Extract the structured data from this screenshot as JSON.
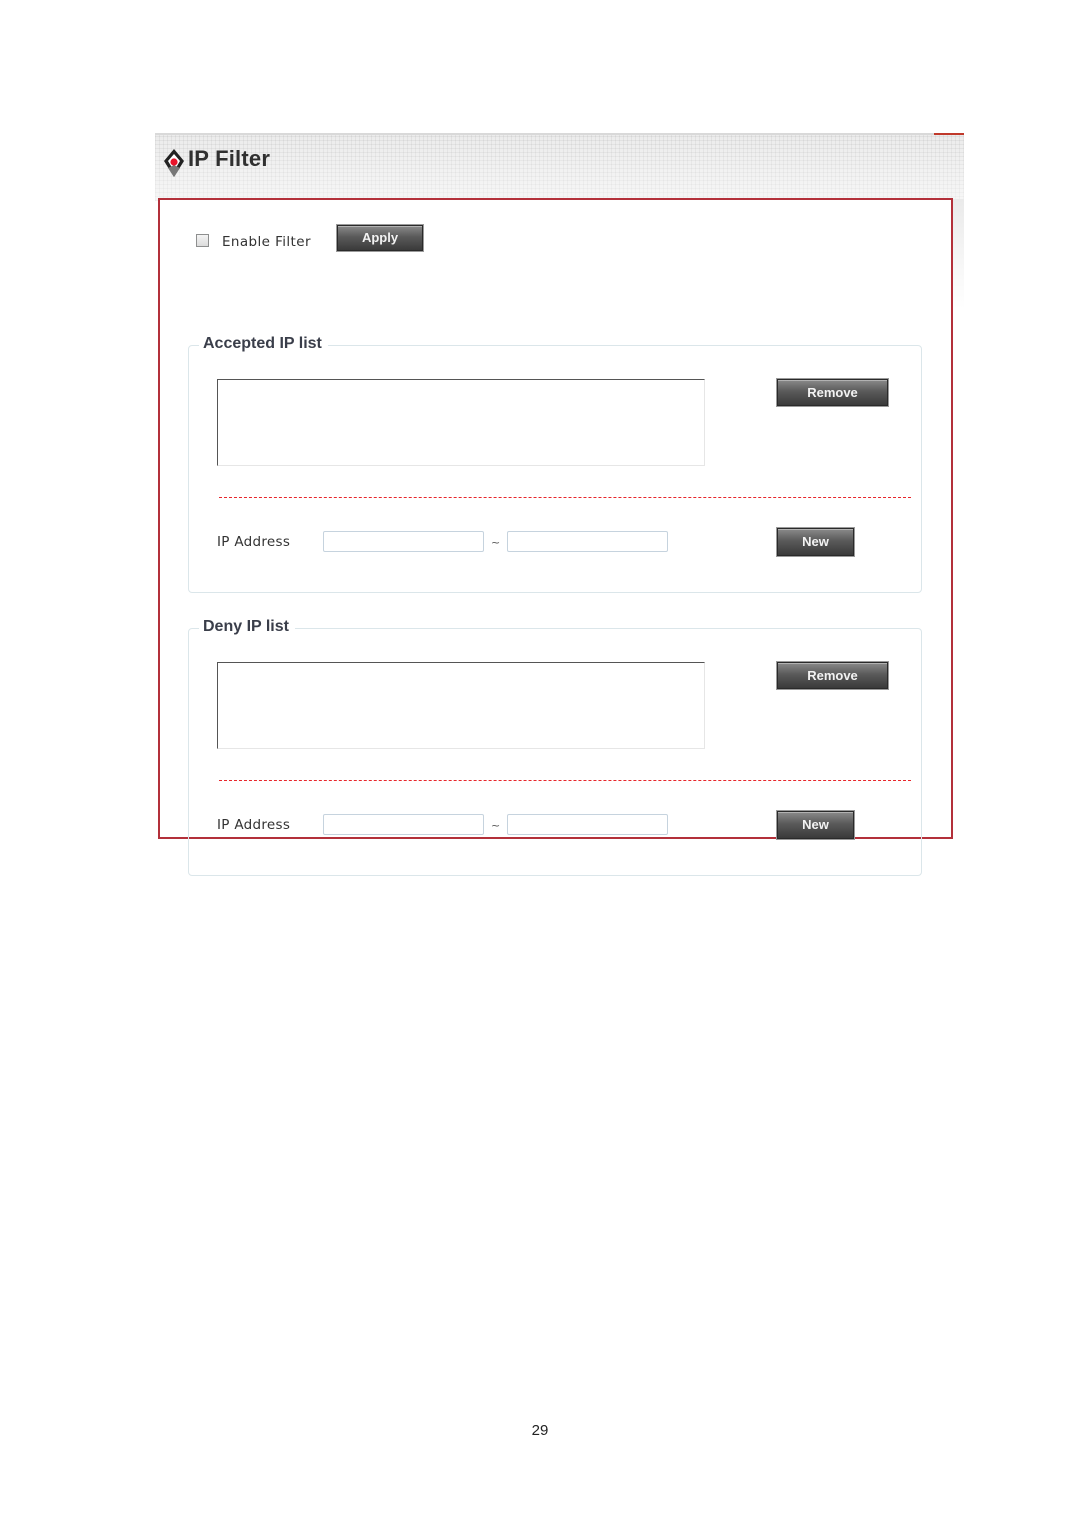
{
  "header": {
    "title": "IP Filter",
    "logo_icon": "diamond-logo-icon"
  },
  "filter": {
    "enable_label": "Enable Filter",
    "enabled": false,
    "apply_label": "Apply"
  },
  "accepted": {
    "legend": "Accepted IP list",
    "items": [],
    "remove_label": "Remove",
    "ip_label": "IP Address",
    "from_value": "",
    "to_value": "",
    "range_separator": "~",
    "new_label": "New"
  },
  "deny": {
    "legend": "Deny IP list",
    "items": [],
    "remove_label": "Remove",
    "ip_label": "IP Address",
    "from_value": "",
    "to_value": "",
    "range_separator": "~",
    "new_label": "New"
  },
  "colors": {
    "frame_border": "#b3303a",
    "dashed_separator": "#e8252b",
    "button_dark": "#3a3a3a"
  },
  "footer": {
    "page_number": "29"
  }
}
